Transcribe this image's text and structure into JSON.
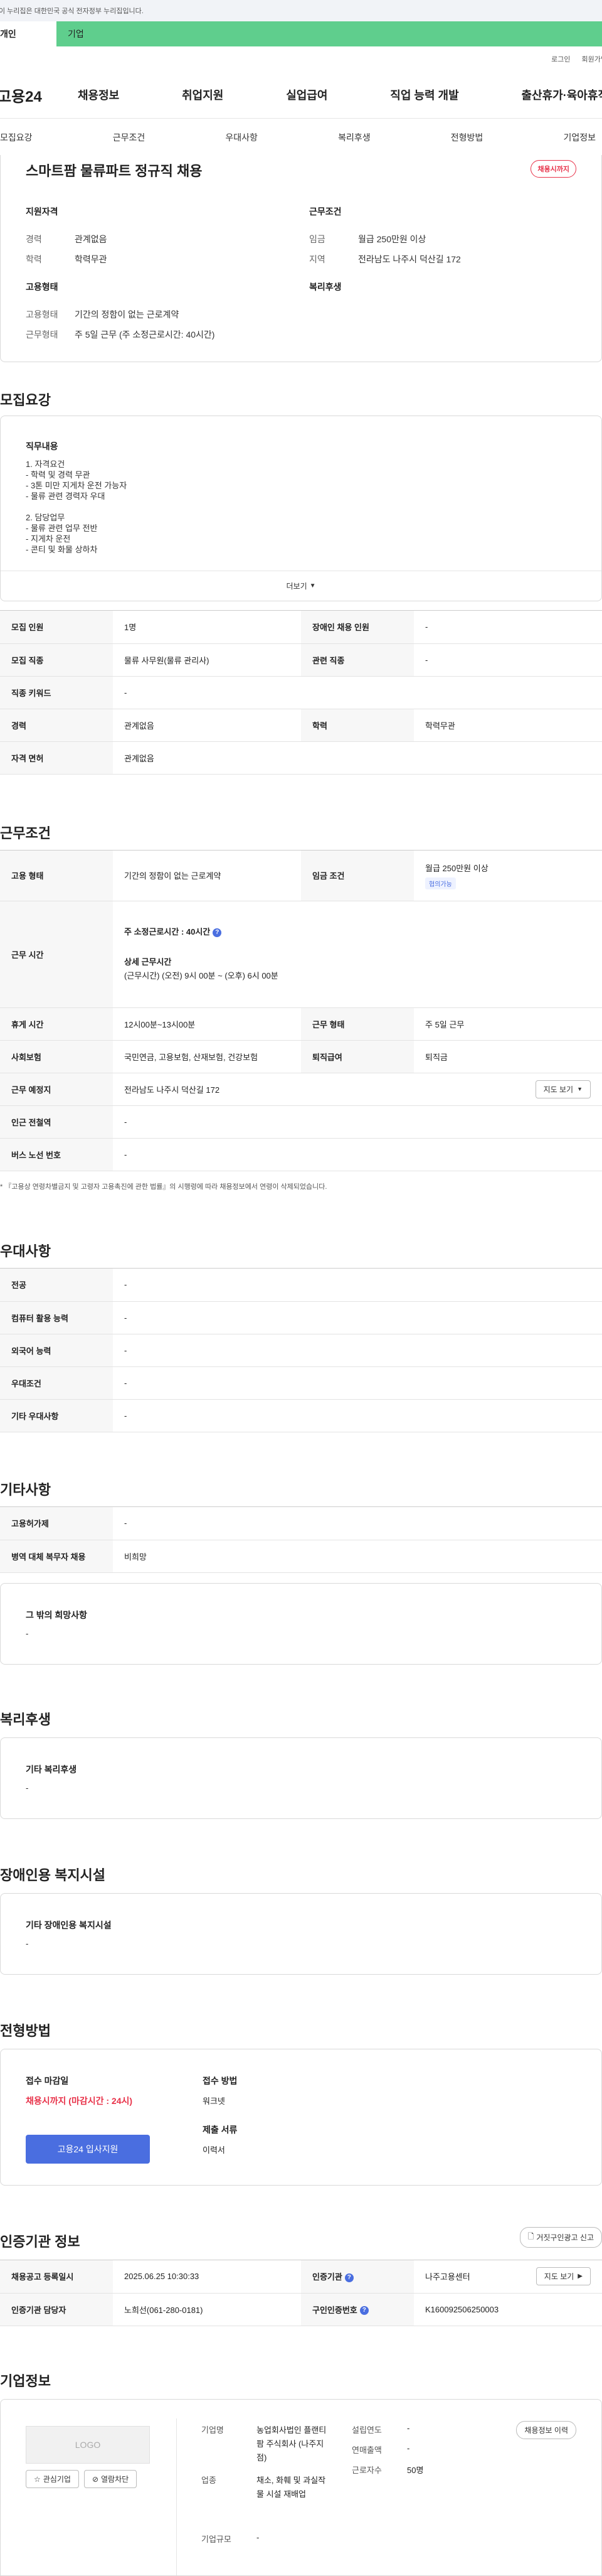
{
  "gov_banner": "이 누리집은 대한민국 공식 전자정부 누리집입니다.",
  "top_tabs": [
    "개인",
    "기업"
  ],
  "util": {
    "login": "로그인",
    "join": "회원가입"
  },
  "logo": "고용24",
  "gnb": [
    "채용정보",
    "취업지원",
    "실업급여",
    "직업 능력 개발",
    "출산휴가·육아휴직"
  ],
  "subnav": [
    "모집요강",
    "근무조건",
    "우대사항",
    "복리후생",
    "전형방법",
    "기업정보"
  ],
  "job": {
    "title": "스마트팜 물류파트 정규직 채용",
    "status": "채용시까지",
    "qual_title": "지원자격",
    "work_title": "근무조건",
    "emp_title": "고용형태",
    "welfare_title": "복리후생",
    "career_k": "경력",
    "career_v": "관계없음",
    "edu_k": "학력",
    "edu_v": "학력무관",
    "wage_k": "임금",
    "wage_v": "월급 250만원 이상",
    "region_k": "지역",
    "region_v": "전라남도 나주시 덕산길 172",
    "emptype_k": "고용형태",
    "emptype_v": "기간의 정함이 없는 근로계약",
    "workform_k": "근무형태",
    "workform_v": "주 5일 근무 (주 소정근로시간: 40시간)"
  },
  "recruit": {
    "title": "모집요강",
    "duty_title": "직무내용",
    "duty_lines": [
      "1. 자격요건",
      "- 학력 및 경력 무관",
      "- 3톤 미만 지게차 운전 가능자",
      "- 물류 관련 경력자 우대",
      "",
      "2. 담당업무",
      "- 물류 관련 업무 전반",
      "- 지게차 운전",
      "- 콘티 및 화물 상하차"
    ],
    "more": "더보기",
    "rows": [
      [
        "모집 인원",
        "1명",
        "장애인 채용 인원",
        "-"
      ],
      [
        "모집 직종",
        "물류 사무원(물류 관리사)",
        "관련 직종",
        "-"
      ],
      [
        "직종 키워드",
        "-"
      ],
      [
        "경력",
        "관계없음",
        "학력",
        "학력무관"
      ],
      [
        "자격 면허",
        "관계없음"
      ]
    ]
  },
  "cond": {
    "title": "근무조건",
    "emp_k": "고용 형태",
    "emp_v": "기간의 정함이 없는 근로계약",
    "wage_k": "임금 조건",
    "wage_v": "월급 250만원 이상",
    "wage_tag": "협의가능",
    "hours_k": "근무 시간",
    "hours_main": "주 소정근로시간 : 40시간",
    "hours_detail_title": "상세 근무시간",
    "hours_detail": "(근무시간) (오전) 9시 00분 ~ (오후) 6시 00분",
    "rest_k": "휴게 시간",
    "rest_v": "12시00분~13시00분",
    "form_k": "근무 형태",
    "form_v": "주 5일 근무",
    "ins_k": "사회보험",
    "ins_v": "국민연금, 고용보험, 산재보험, 건강보험",
    "sev_k": "퇴직급여",
    "sev_v": "퇴직금",
    "place_k": "근무 예정지",
    "place_v": "전라남도 나주시 덕산길 172",
    "map_btn": "지도 보기",
    "station_k": "인근 전철역",
    "station_v": "-",
    "bus_k": "버스 노선 번호",
    "bus_v": "-",
    "note": "* 『고용상 연령차별금지 및 고령자 고용촉진에 관한 법률』의 시행령에 따라 채용정보에서 연령이 삭제되었습니다."
  },
  "pref": {
    "title": "우대사항",
    "rows": [
      [
        "전공",
        "-"
      ],
      [
        "컴퓨터 활용 능력",
        "-"
      ],
      [
        "외국어 능력",
        "-"
      ],
      [
        "우대조건",
        "-"
      ],
      [
        "기타 우대사항",
        "-"
      ]
    ]
  },
  "etc": {
    "title": "기타사항",
    "rows": [
      [
        "고용허가제",
        "-"
      ],
      [
        "병역 대체 복무자 채용",
        "비희망"
      ]
    ],
    "box_title": "그 밖의 희망사항",
    "box_v": "-"
  },
  "welfare": {
    "title": "복리후생",
    "box_title": "기타 복리후생",
    "box_v": "-"
  },
  "disab": {
    "title": "장애인용 복지시설",
    "box_title": "기타 장애인용 복지시설",
    "box_v": "-"
  },
  "screen": {
    "title": "전형방법",
    "deadline_k": "접수 마감일",
    "deadline_v": "채용시까지 (마감시간 : 24시)",
    "apply_btn": "고용24 입사지원",
    "method_k": "접수 방법",
    "method_v": "워크넷",
    "docs_k": "제출 서류",
    "docs_v": "이력서"
  },
  "cert": {
    "title": "인증기관 정보",
    "report_btn": "거짓구인광고 신고",
    "reg_k": "채용공고 등록일시",
    "reg_v": "2025.06.25 10:30:33",
    "org_k": "인증기관",
    "org_v": "나주고용센터",
    "map_btn": "지도 보기",
    "staff_k": "인증기관 담당자",
    "staff_v": "노희선(061-280-0181)",
    "no_k": "구인인증번호",
    "no_v": "K160092506250003"
  },
  "company": {
    "title": "기업정보",
    "logo": "LOGO",
    "fav_btn": "관심기업",
    "block_btn": "열람차단",
    "name_k": "기업명",
    "name_v": "농업회사법인 플랜티팜 주식회사 (나주지점)",
    "ind_k": "업종",
    "ind_v": "채소, 화훼 및 과실작물 시설 재배업",
    "size_k": "기업규모",
    "size_v": "-",
    "est_k": "설립연도",
    "est_v": "-",
    "sales_k": "연매출액",
    "sales_v": "-",
    "emp_k": "근로자수",
    "emp_v": "50명",
    "history_btn": "채용정보 이력"
  }
}
